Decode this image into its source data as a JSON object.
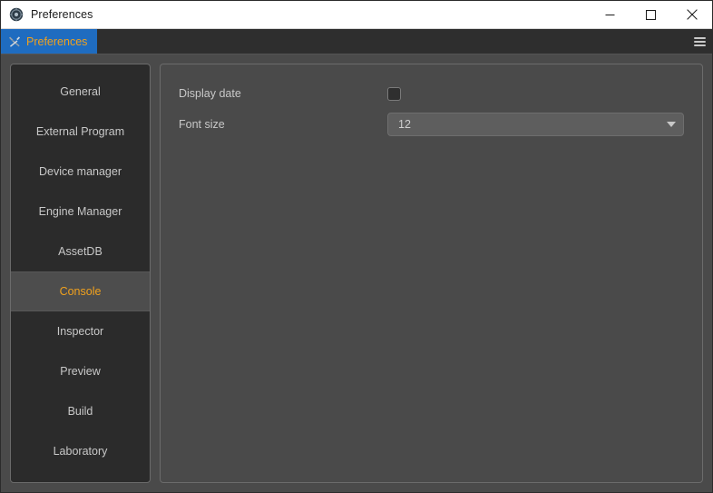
{
  "window": {
    "title": "Preferences",
    "icon": "app-gear-icon",
    "controls": {
      "minimize": "minimize-icon",
      "maximize": "maximize-icon",
      "close": "close-icon"
    }
  },
  "tabbar": {
    "tabs": [
      {
        "label": "Preferences",
        "icon": "tools-icon",
        "active": true
      }
    ],
    "menu_icon": "hamburger-menu-icon"
  },
  "sidebar": {
    "items": [
      {
        "label": "General",
        "selected": false
      },
      {
        "label": "External Program",
        "selected": false
      },
      {
        "label": "Device manager",
        "selected": false
      },
      {
        "label": "Engine Manager",
        "selected": false
      },
      {
        "label": "AssetDB",
        "selected": false
      },
      {
        "label": "Console",
        "selected": true
      },
      {
        "label": "Inspector",
        "selected": false
      },
      {
        "label": "Preview",
        "selected": false
      },
      {
        "label": "Build",
        "selected": false
      },
      {
        "label": "Laboratory",
        "selected": false
      }
    ]
  },
  "main": {
    "fields": [
      {
        "label": "Display date",
        "type": "checkbox",
        "checked": false
      },
      {
        "label": "Font size",
        "type": "dropdown",
        "value": "12",
        "caret": "chevron-down-icon"
      }
    ]
  },
  "colors": {
    "accent_tab": "#1f6cc0",
    "accent_text": "#f0a11e",
    "panel_bg": "#4a4a4a",
    "sidebar_bg": "#2b2b2b",
    "selected_item_bg": "#4d4d4d"
  }
}
